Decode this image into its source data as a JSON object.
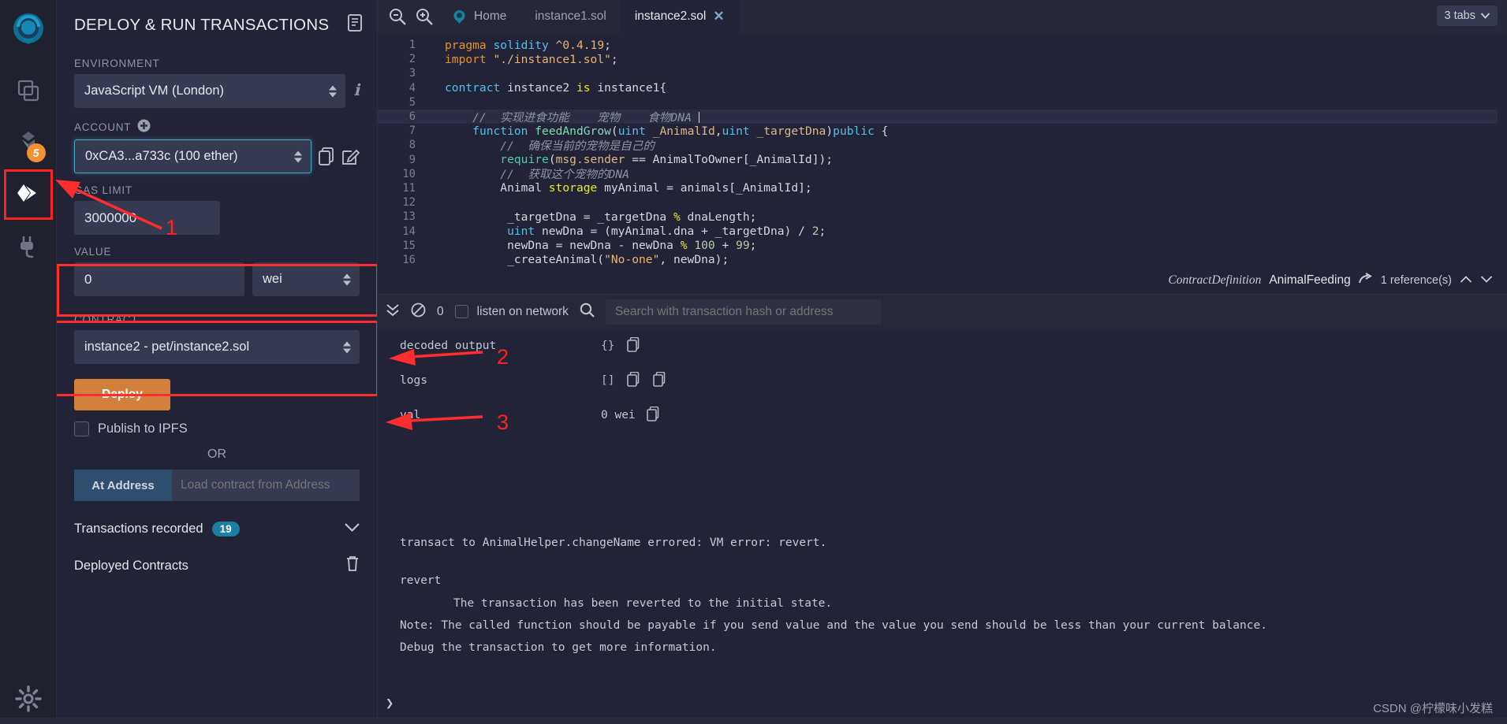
{
  "iconbar": {
    "items": [
      {
        "name": "remix-logo",
        "label": "Remix"
      },
      {
        "name": "file-explorer",
        "label": "File explorers"
      },
      {
        "name": "solidity-compiler",
        "label": "Solidity compiler",
        "badge": "5"
      },
      {
        "name": "deploy-run",
        "label": "Deploy & run transactions"
      },
      {
        "name": "plugin-manager",
        "label": "Plugin manager"
      },
      {
        "name": "settings",
        "label": "Settings"
      }
    ]
  },
  "panel": {
    "title": "DEPLOY & RUN TRANSACTIONS",
    "environment_label": "ENVIRONMENT",
    "environment_value": "JavaScript VM (London)",
    "account_label": "ACCOUNT",
    "account_value": "0xCA3...a733c (100 ether)",
    "gas_limit_label": "GAS LIMIT",
    "gas_limit_value": "3000000",
    "value_label": "VALUE",
    "value_value": "0",
    "value_unit": "wei",
    "contract_label": "CONTRACT",
    "contract_value": "instance2 - pet/instance2.sol",
    "deploy_label": "Deploy",
    "publish_ipfs_label": "Publish to IPFS",
    "or_label": "OR",
    "at_address_label": "At Address",
    "at_address_placeholder": "Load contract from Address",
    "transactions_recorded_label": "Transactions recorded",
    "transactions_recorded_count": "19",
    "deployed_contracts_label": "Deployed Contracts"
  },
  "annotations": [
    {
      "number": "1"
    },
    {
      "number": "2"
    },
    {
      "number": "3"
    }
  ],
  "tabbar": {
    "zoom_out": "zoom-out-icon",
    "zoom_in": "zoom-in-icon",
    "home_label": "Home",
    "tabs": [
      {
        "label": "instance1.sol",
        "active": false
      },
      {
        "label": "instance2.sol",
        "active": true
      }
    ],
    "tabs_count_label": "3 tabs"
  },
  "editor": {
    "lines": [
      {
        "n": "1",
        "fold": false
      },
      {
        "n": "2",
        "fold": false
      },
      {
        "n": "3",
        "fold": false
      },
      {
        "n": "4",
        "fold": true
      },
      {
        "n": "5",
        "fold": false
      },
      {
        "n": "6",
        "fold": false
      },
      {
        "n": "7",
        "fold": true
      },
      {
        "n": "8",
        "fold": false
      },
      {
        "n": "9",
        "fold": false
      },
      {
        "n": "10",
        "fold": false
      },
      {
        "n": "11",
        "fold": false
      },
      {
        "n": "12",
        "fold": false
      },
      {
        "n": "13",
        "fold": false
      },
      {
        "n": "14",
        "fold": false
      },
      {
        "n": "15",
        "fold": false
      },
      {
        "n": "16",
        "fold": false
      }
    ],
    "code": [
      "pragma solidity ^0.4.19;",
      "import \"./instance1.sol\";",
      "",
      "contract instance2 is instance1{",
      "",
      "    //  实现进食功能    宠物    食物DNA",
      "    function feedAndGrow(uint _AnimalId,uint _targetDna)public {",
      "        //  确保当前的宠物是自己的",
      "        require(msg.sender == AnimalToOwner[_AnimalId]);",
      "        //  获取这个宠物的DNA",
      "        Animal storage myAnimal = animals[_AnimalId];",
      "",
      "        _targetDna = _targetDna % dnaLength;",
      "        uint newDna = (myAnimal.dna + _targetDna) / 2;",
      "        newDna = newDna - newDna % 100 + 99;",
      "        _createAnimal(\"No-one\", newDna);"
    ],
    "active_line": 6
  },
  "context_bar": {
    "kind": "ContractDefinition",
    "name": "AnimalFeeding",
    "references": "1 reference(s)"
  },
  "terminal": {
    "pending_count": "0",
    "listen_on_network_label": "listen on network",
    "search_placeholder": "Search with transaction hash or address",
    "rows": [
      {
        "key": "decoded output",
        "value": "",
        "icons": [
          "braces-icon",
          "copy-icon"
        ]
      },
      {
        "key": "logs",
        "value": "",
        "icons": [
          "brackets-icon",
          "copy-icon",
          "copy-icon"
        ]
      },
      {
        "key": "val",
        "value": "0 wei",
        "icons": [
          "copy-icon"
        ]
      }
    ],
    "log_lines": [
      "transact to AnimalHelper.changeName errored: VM error: revert.",
      "revert",
      "\tThe transaction has been reverted to the initial state.",
      "Note: The called function should be payable if you send value and the value you send should be less than your current balance.",
      "Debug the transaction to get more information."
    ],
    "prompt": "❯",
    "watermark": "CSDN @柠檬味小发糕"
  },
  "colors": {
    "accent_orange": "#d3803c",
    "accent_blue": "#1a7fa0",
    "annotation_red": "#ff2d2d",
    "badge_orange": "#f3902f"
  }
}
